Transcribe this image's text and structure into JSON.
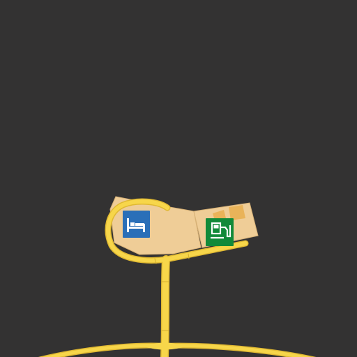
{
  "map": {
    "background_color": "#333232",
    "road_color": "#f7d64a",
    "road_edge_color": "#e8c23a",
    "building_color": "#efcd97",
    "building_edge_color": "#d8b277",
    "building_accent_color": "#e7aa44"
  },
  "pois": [
    {
      "id": "hotel",
      "icon": "bed-icon",
      "color": "#2a6fb8"
    },
    {
      "id": "station",
      "icon": "fuel-pump-icon",
      "color": "#118a39"
    }
  ]
}
